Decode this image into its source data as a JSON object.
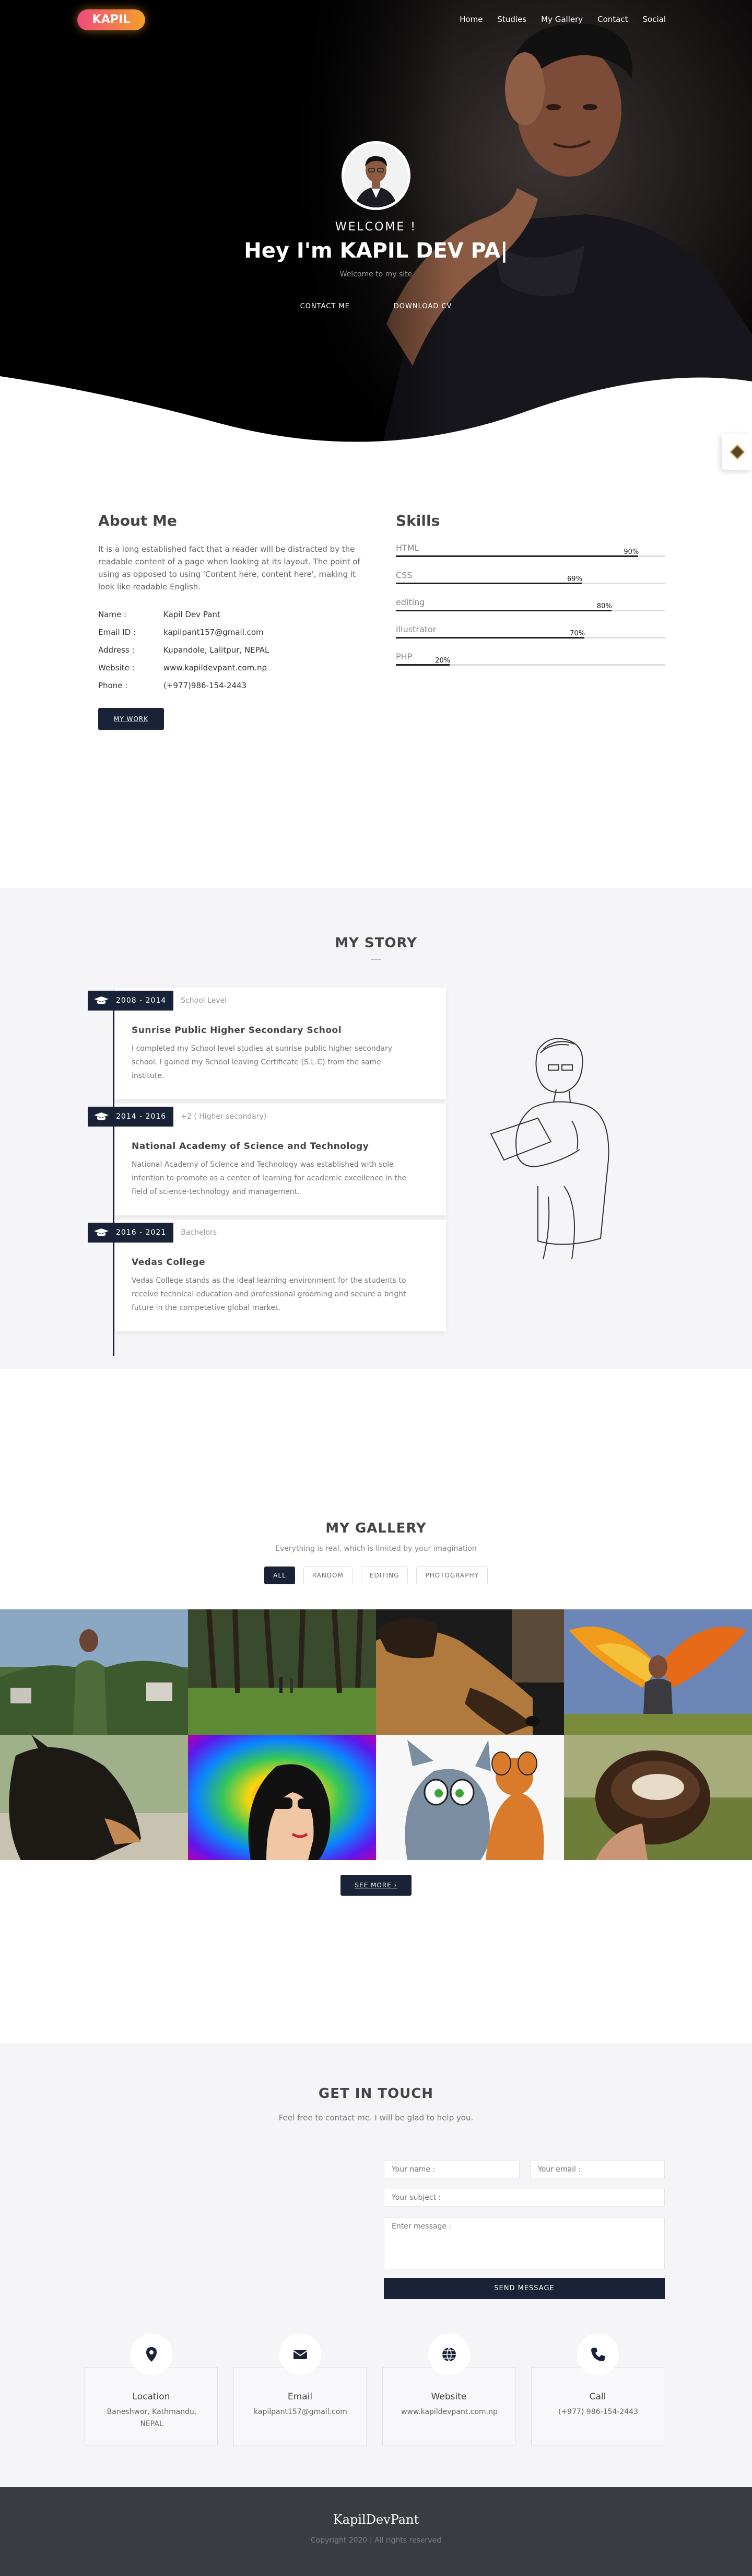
{
  "nav": {
    "logo": "KAPIL",
    "links": [
      "Home",
      "Studies",
      "My Gallery",
      "Contact",
      "Social"
    ]
  },
  "hero": {
    "welcome": "WELCOME !",
    "title": "Hey I'm KAPIL DEV PA|",
    "subtitle": "Welcome to my site",
    "btn_contact": "CONTACT ME",
    "btn_cv": "DOWNLOAD CV"
  },
  "about": {
    "heading": "About Me",
    "text": "It is a long established fact that a reader will be distracted by the readable content of a page when looking at its layout. The point of using as opposed to using 'Content here, content here', making it look like readable English.",
    "info": [
      {
        "key": "Name :",
        "value": "Kapil Dev Pant"
      },
      {
        "key": "Email ID :",
        "value": "kapilpant157@gmail.com"
      },
      {
        "key": "Address :",
        "value": "Kupandole, Lalitpur, NEPAL"
      },
      {
        "key": "Website :",
        "value": "www.kapildevpant.com.np"
      },
      {
        "key": "Phone :",
        "value": "(+977)986-154-2443"
      }
    ],
    "button": "MY WORK"
  },
  "skills": {
    "heading": "Skills",
    "items": [
      {
        "name": "HTML",
        "percent": 90,
        "label": "90%"
      },
      {
        "name": "CSS",
        "percent": 69,
        "label": "69%"
      },
      {
        "name": "editing",
        "percent": 80,
        "label": "80%"
      },
      {
        "name": "Illustrator",
        "percent": 70,
        "label": "70%"
      },
      {
        "name": "PHP",
        "percent": 20,
        "label": "20%"
      }
    ]
  },
  "story": {
    "title": "MY STORY",
    "items": [
      {
        "years": "2008 - 2014",
        "level": "School Level",
        "title": "Sunrise Public Higher Secondary School",
        "desc": "I completed my School level studies at sunrise public higher secondary school. I gained my School leaving Certificate (S.L.C) from the same institute."
      },
      {
        "years": "2014 - 2016",
        "level": "+2 ( Higher secondary)",
        "title": "National Academy of Science and Technology",
        "desc": "National Academy of Science and Technology was established with sole intention to promote as a center of learning for academic excellence in the field of science-technology and management."
      },
      {
        "years": "2016 - 2021",
        "level": "Bachelors",
        "title": "Vedas College",
        "desc": "Vedas College stands as the ideal learning environment for the students to receive technical education and professional grooming and secure a bright future in the competetive global market."
      }
    ]
  },
  "gallery": {
    "title": "MY GALLERY",
    "subtitle": "Everything is real, which is limited by your imagination",
    "filters": [
      "ALL",
      "RANDOM",
      "EDITING",
      "PHOTOGRAPHY"
    ],
    "more": "SEE MORE ›"
  },
  "contact": {
    "title": "GET IN TOUCH",
    "subtitle": "Feel free to contact me. I will be glad to help you.",
    "name_ph": "Your name :",
    "email_ph": "Your email :",
    "subject_ph": "Your subject :",
    "message_ph": "Enter message :",
    "send": "SEND MESSAGE",
    "cards": [
      {
        "label": "Location",
        "value": "Baneshwor, Kathmandu, NEPAL"
      },
      {
        "label": "Email",
        "value": "kapilpant157@gmail.com"
      },
      {
        "label": "Website",
        "value": "www.kapildevpant.com.np"
      },
      {
        "label": "Call",
        "value": "(+977) 986-154-2443"
      }
    ]
  },
  "footer": {
    "brand": "KapilDevPant",
    "copy": "Copyright 2020 | All rights reserved"
  },
  "colors": {
    "navy": "#1a2238",
    "logo_gradient_start": "#f04a7c",
    "logo_gradient_end": "#f5a12a",
    "footer_bg": "#3a3c41"
  }
}
